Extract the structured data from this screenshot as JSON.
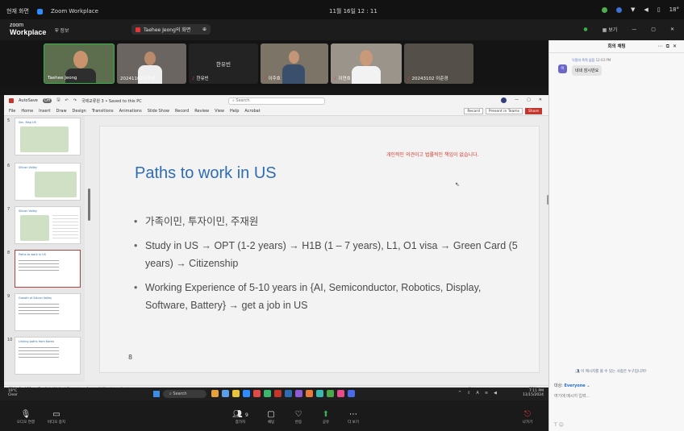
{
  "os_bar": {
    "left_items": [
      "현재 화면",
      "Zoom Workplace"
    ],
    "clock": "11월 16일 12 : 11",
    "right_glyph": "18°"
  },
  "zoom_header": {
    "logo_top": "zoom",
    "logo_bottom": "Workplace",
    "info": "정보",
    "share_label": "Taehee Jeong의 화면",
    "view_label": "보기",
    "colors": {
      "accent": "#37b24d",
      "record": "#e0363c"
    }
  },
  "participants": [
    {
      "name": "Taehee Jeong",
      "muted": false,
      "has_video": true,
      "active": true
    },
    {
      "name": "20241101이주영",
      "muted": false,
      "has_video": true,
      "active": false
    },
    {
      "name": "한유빈",
      "muted": true,
      "has_video": false,
      "active": false,
      "center_name": "한유빈"
    },
    {
      "name": "이주호",
      "muted": true,
      "has_video": true,
      "active": false
    },
    {
      "name": "이연호",
      "muted": true,
      "has_video": true,
      "active": false
    },
    {
      "name": "20243102 이준경",
      "muted": true,
      "has_video": false,
      "active": false
    }
  ],
  "ppt": {
    "autosave": "AutoSave",
    "autosave_state": "Off",
    "doc_title": "국제교류원 3 • Saved to this PC",
    "search_placeholder": "Search",
    "menus": [
      "File",
      "Home",
      "Insert",
      "Draw",
      "Design",
      "Transitions",
      "Animations",
      "Slide Show",
      "Record",
      "Review",
      "View",
      "Help",
      "Acrobat"
    ],
    "ribbon_buttons": [
      "Record",
      "Present in Teams",
      "Share"
    ],
    "thumbnails": [
      {
        "num": "5",
        "title": "Sec. Map US"
      },
      {
        "num": "6",
        "title": "Silicon Valley"
      },
      {
        "num": "7",
        "title": "Silicon Valley"
      },
      {
        "num": "8",
        "title": "Paths to work in US",
        "selected": true
      },
      {
        "num": "9",
        "title": "Growth of Silicon Valley"
      },
      {
        "num": "10",
        "title": "Linking paths from Korea"
      }
    ],
    "status": [
      "Slide 8 of 21",
      "English (United States)",
      "Accessibility: Investigate",
      "Notes",
      "52%"
    ]
  },
  "slide": {
    "disclaimer": "개인적인 의견이고 법률적인 책임이 없습니다.",
    "title": "Paths to work in US",
    "bullets": [
      "가족이민, 투자이민, 주재원",
      "Study in US → OPT (1-2 years) → H1B (1 – 7 years), L1, O1 visa → Green Card (5 years) → Citizenship",
      "Working Experience of 5-10 years in {AI, Semiconductor, Robotics, Display, Software, Battery} → get a job in US"
    ],
    "page_number": "8"
  },
  "taskbar": {
    "weather": [
      "19°C",
      "Clear"
    ],
    "search_placeholder": "Search",
    "time": "7:11 PM",
    "date": "11/15/2024"
  },
  "controls": [
    {
      "icon": "mic-icon",
      "label": "오디오 연결"
    },
    {
      "icon": "video-icon",
      "label": "비디오 중지"
    },
    {
      "icon": "participants-icon",
      "label": "참가자",
      "count": "9"
    },
    {
      "icon": "chat-icon",
      "label": "채팅"
    },
    {
      "icon": "react-icon",
      "label": "반응"
    },
    {
      "icon": "share-icon",
      "label": "공유"
    },
    {
      "icon": "more-icon",
      "label": "더 보기"
    },
    {
      "icon": "leave-icon",
      "label": "나가기"
    }
  ],
  "chat": {
    "title": "회의 채팅",
    "sender": "익명의 목적 없음",
    "time": "12:03 PM",
    "avatar": "이",
    "message": "네네 잠시만요",
    "who_can_see": "이 메시지를 볼 수 있는 사람은 누구입니까?",
    "to_label": "대상:",
    "to_value": "Everyone",
    "input_placeholder": "여기에 메시지 입력..."
  }
}
